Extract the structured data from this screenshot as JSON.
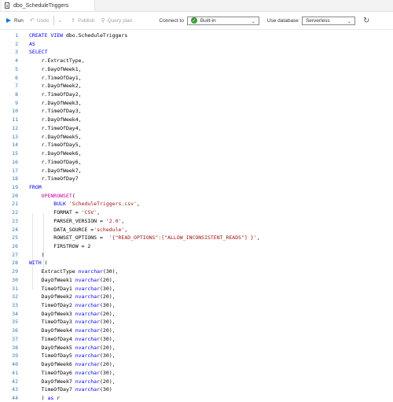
{
  "tab": {
    "title": "dbo_ScheduleTriggers",
    "icon": "document-icon"
  },
  "toolbar": {
    "run_label": "Run",
    "undo_label": "Undo",
    "publish_label": "Publish",
    "query_plan_label": "Query plan",
    "connect_to_label": "Connect to",
    "connect_to_value": "Built-in",
    "use_database_label": "Use database",
    "use_database_value": "Serverless"
  },
  "editor": {
    "lines": [
      [
        [
          "kw",
          "CREATE VIEW "
        ],
        [
          "plain",
          "dbo.ScheduleTriggers"
        ]
      ],
      [
        [
          "kw",
          "AS"
        ]
      ],
      [
        [
          "kw",
          "SELECT"
        ]
      ],
      [
        [
          "plain",
          "    r.ExtractType,"
        ]
      ],
      [
        [
          "plain",
          "    r.DayOfWeek1,"
        ]
      ],
      [
        [
          "plain",
          "    r.TimeOfDay1,"
        ]
      ],
      [
        [
          "plain",
          "    r.DayOfWeek2,"
        ]
      ],
      [
        [
          "plain",
          "    r.TimeOfDay2,"
        ]
      ],
      [
        [
          "plain",
          "    r.DayOfWeek3,"
        ]
      ],
      [
        [
          "plain",
          "    r.TimeOfDay3,"
        ]
      ],
      [
        [
          "plain",
          "    r.DayOfWeek4,"
        ]
      ],
      [
        [
          "plain",
          "    r.TimeOfDay4,"
        ]
      ],
      [
        [
          "plain",
          "    r.DayOfWeek5,"
        ]
      ],
      [
        [
          "plain",
          "    r.TimeOfDay5,"
        ]
      ],
      [
        [
          "plain",
          "    r.DayOfWeek6,"
        ]
      ],
      [
        [
          "plain",
          "    r.TimeOfDay6,"
        ]
      ],
      [
        [
          "plain",
          "    r.DayOfWeek7,"
        ]
      ],
      [
        [
          "plain",
          "    r.TimeOfDay7"
        ]
      ],
      [
        [
          "kw",
          "FROM"
        ]
      ],
      [
        [
          "fn",
          "    OPENROWSET"
        ],
        [
          "plain",
          "("
        ]
      ],
      [
        [
          "kw",
          "        BULK "
        ],
        [
          "str",
          "'ScheduleTriggers.csv'"
        ],
        [
          "plain",
          ","
        ]
      ],
      [
        [
          "plain",
          "        FORMAT "
        ],
        [
          "plain",
          "= "
        ],
        [
          "str",
          "'CSV'"
        ],
        [
          "plain",
          ","
        ]
      ],
      [
        [
          "plain",
          "        PARSER_VERSION = "
        ],
        [
          "str",
          "'2.0'"
        ],
        [
          "plain",
          ","
        ]
      ],
      [
        [
          "plain",
          "        DATA_SOURCE ="
        ],
        [
          "str",
          "'schedule'"
        ],
        [
          "plain",
          ","
        ]
      ],
      [
        [
          "plain",
          "        ROWSET_OPTIONS =  "
        ],
        [
          "str",
          "'{\"READ_OPTIONS\":[\"ALLOW_INCONSISTENT_READS\"] }'"
        ],
        [
          "plain",
          ","
        ]
      ],
      [
        [
          "plain",
          "        FIRSTROW = 2"
        ]
      ],
      [
        [
          "plain",
          "    )"
        ]
      ],
      [
        [
          "kw",
          "WITH "
        ],
        [
          "plain",
          "("
        ]
      ],
      [
        [
          "plain",
          "    ExtractType "
        ],
        [
          "ty",
          "nvarchar"
        ],
        [
          "plain",
          "(30),"
        ]
      ],
      [
        [
          "plain",
          "    DayOfWeek1 "
        ],
        [
          "ty",
          "nvarchar"
        ],
        [
          "plain",
          "(20),"
        ]
      ],
      [
        [
          "plain",
          "    TimeOfDay1 "
        ],
        [
          "ty",
          "nvarchar"
        ],
        [
          "plain",
          "(30),"
        ]
      ],
      [
        [
          "plain",
          "    DayOfWeek2 "
        ],
        [
          "ty",
          "nvarchar"
        ],
        [
          "plain",
          "(20),"
        ]
      ],
      [
        [
          "plain",
          "    TimeOfDay2 "
        ],
        [
          "ty",
          "nvarchar"
        ],
        [
          "plain",
          "(30),"
        ]
      ],
      [
        [
          "plain",
          "    DayOfWeek3 "
        ],
        [
          "ty",
          "nvarchar"
        ],
        [
          "plain",
          "(20),"
        ]
      ],
      [
        [
          "plain",
          "    TimeOfDay3 "
        ],
        [
          "ty",
          "nvarchar"
        ],
        [
          "plain",
          "(30),"
        ]
      ],
      [
        [
          "plain",
          "    DayOfWeek4 "
        ],
        [
          "ty",
          "nvarchar"
        ],
        [
          "plain",
          "(20),"
        ]
      ],
      [
        [
          "plain",
          "    TimeOfDay4 "
        ],
        [
          "ty",
          "nvarchar"
        ],
        [
          "plain",
          "(30),"
        ]
      ],
      [
        [
          "plain",
          "    DayOfWeek5 "
        ],
        [
          "ty",
          "nvarchar"
        ],
        [
          "plain",
          "(20),"
        ]
      ],
      [
        [
          "plain",
          "    TimeOfDay5 "
        ],
        [
          "ty",
          "nvarchar"
        ],
        [
          "plain",
          "(30),"
        ]
      ],
      [
        [
          "plain",
          "    DayOfWeek6 "
        ],
        [
          "ty",
          "nvarchar"
        ],
        [
          "plain",
          "(20),"
        ]
      ],
      [
        [
          "plain",
          "    TimeOfDay6 "
        ],
        [
          "ty",
          "nvarchar"
        ],
        [
          "plain",
          "(30),"
        ]
      ],
      [
        [
          "plain",
          "    DayOfWeek7 "
        ],
        [
          "ty",
          "nvarchar"
        ],
        [
          "plain",
          "(20),"
        ]
      ],
      [
        [
          "plain",
          "    TimeOfDay7 "
        ],
        [
          "ty",
          "nvarchar"
        ],
        [
          "plain",
          "(30)"
        ]
      ],
      [
        [
          "plain",
          "    ) "
        ],
        [
          "kw",
          "as "
        ],
        [
          "plain",
          "r"
        ]
      ]
    ]
  }
}
